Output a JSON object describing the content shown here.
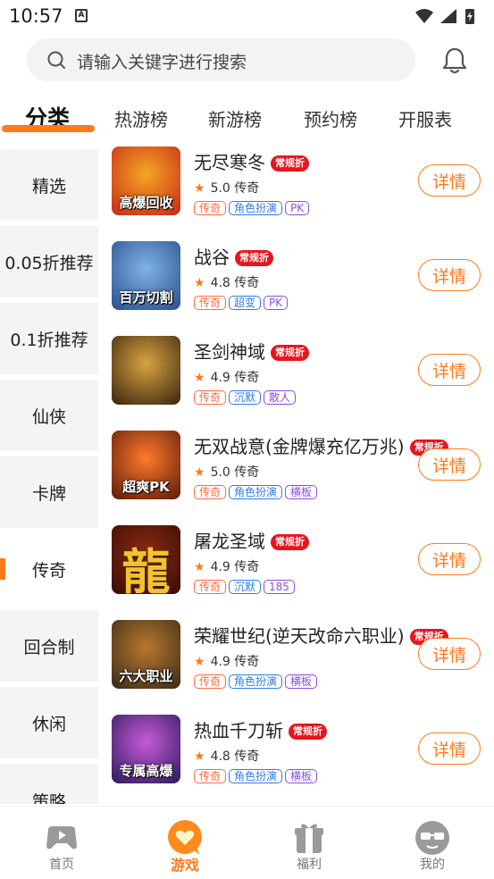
{
  "status": {
    "time": "10:57",
    "notif": "A"
  },
  "search": {
    "placeholder": "请输入关键字进行搜索"
  },
  "top_tabs": [
    {
      "label": "分类",
      "active": true
    },
    {
      "label": "热游榜"
    },
    {
      "label": "新游榜"
    },
    {
      "label": "预约榜"
    },
    {
      "label": "开服表"
    }
  ],
  "sidebar": {
    "items": [
      {
        "label": "精选"
      },
      {
        "label": "0.05折推荐"
      },
      {
        "label": "0.1折推荐"
      },
      {
        "label": "仙侠"
      },
      {
        "label": "卡牌"
      },
      {
        "label": "传奇",
        "active": true
      },
      {
        "label": "回合制"
      },
      {
        "label": "休闲"
      },
      {
        "label": "策略"
      }
    ]
  },
  "games": [
    {
      "name": "无尽寒冬",
      "badge": "常规折",
      "rating": "5.0",
      "genre": "传奇",
      "tags": [
        "传奇",
        "角色扮演",
        "PK"
      ],
      "thumb_text": "高爆回收",
      "thumb_colors": [
        "#c6281a",
        "#f5a623"
      ],
      "detail": "详情"
    },
    {
      "name": "战谷",
      "badge": "常规折",
      "rating": "4.8",
      "genre": "传奇",
      "tags": [
        "传奇",
        "超变",
        "PK"
      ],
      "thumb_text": "百万切割",
      "thumb_colors": [
        "#2a4e8a",
        "#7fb3e6"
      ],
      "detail": "详情"
    },
    {
      "name": "圣剑神域",
      "badge": "常规折",
      "rating": "4.9",
      "genre": "传奇",
      "tags": [
        "传奇",
        "沉默",
        "散人"
      ],
      "thumb_text": "",
      "thumb_colors": [
        "#3a2410",
        "#d8a440"
      ],
      "detail": "详情"
    },
    {
      "name": "无双战意(金牌爆充亿万兆)",
      "badge": "常规折",
      "rating": "5.0",
      "genre": "传奇",
      "tags": [
        "传奇",
        "角色扮演",
        "横板"
      ],
      "thumb_text": "超爽PK",
      "thumb_colors": [
        "#5a1a0a",
        "#ff7a2a"
      ],
      "detail": "详情"
    },
    {
      "name": "屠龙圣域",
      "badge": "常规折",
      "rating": "4.9",
      "genre": "传奇",
      "tags": [
        "传奇",
        "沉默",
        "185"
      ],
      "thumb_text": "",
      "thumb_big": "龍",
      "thumb_colors": [
        "#3a0c06",
        "#8a2a10"
      ],
      "detail": "详情"
    },
    {
      "name": "荣耀世纪(逆天改命六职业)",
      "badge": "常规折",
      "rating": "4.9",
      "genre": "传奇",
      "tags": [
        "传奇",
        "角色扮演",
        "横板"
      ],
      "thumb_text": "六大职业",
      "thumb_colors": [
        "#3a2a18",
        "#b8782e"
      ],
      "detail": "详情"
    },
    {
      "name": "热血千刀斩",
      "badge": "常规折",
      "rating": "4.8",
      "genre": "传奇",
      "tags": [
        "传奇",
        "角色扮演",
        "横板"
      ],
      "thumb_text": "专属高爆",
      "thumb_colors": [
        "#2a1a5a",
        "#c85ad8"
      ],
      "detail": "详情"
    }
  ],
  "bottom_nav": [
    {
      "label": "首页",
      "icon": "gamepad-icon"
    },
    {
      "label": "游戏",
      "icon": "game-bubble-icon",
      "active": true
    },
    {
      "label": "福利",
      "icon": "gift-icon"
    },
    {
      "label": "我的",
      "icon": "avatar-icon"
    }
  ],
  "colors": {
    "accent": "#ff7a1a",
    "badge": "#e8141e",
    "sidebar_bg": "#f4f4f4"
  }
}
